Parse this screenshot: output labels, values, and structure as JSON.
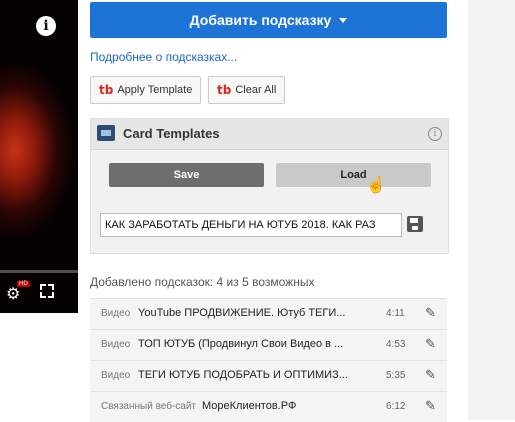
{
  "video": {
    "info_icon": "info-icon",
    "settings_icon": "gear-icon",
    "hd_badge": "HD",
    "fullscreen_icon": "fullscreen-icon"
  },
  "header": {
    "add_button_label": "Добавить подсказку",
    "more_link": "Подробнее о подсказках..."
  },
  "toolbar": {
    "apply_label": "Apply Template",
    "clear_label": "Clear All",
    "tb_icon": "tb"
  },
  "card_templates": {
    "title": "Card Templates",
    "save_label": "Save",
    "load_label": "Load",
    "template_value": "КАК ЗАРАБОТАТЬ ДЕНЬГИ НА ЮТУБ 2018. КАК РАЗ"
  },
  "cards_count": "Добавлено подсказок: 4 из 5 возможных",
  "cards": [
    {
      "type": "Видео",
      "title": "YouTube ПРОДВИЖЕНИЕ. Ютуб ТЕГИ...",
      "time": "4:11"
    },
    {
      "type": "Видео",
      "title": "ТОП ЮТУБ (Продвинул Свои Видео в ...",
      "time": "4:53"
    },
    {
      "type": "Видео",
      "title": "ТЕГИ ЮТУБ ПОДОБРАТЬ И ОПТИМИЗ...",
      "time": "5:35"
    },
    {
      "type": "Связанный веб-сайт",
      "title": "МореКлиентов.РФ",
      "time": "6:12"
    }
  ],
  "colors": {
    "accent": "#1e73d6",
    "link": "#1a66c7",
    "tb_red": "#d6281c"
  }
}
